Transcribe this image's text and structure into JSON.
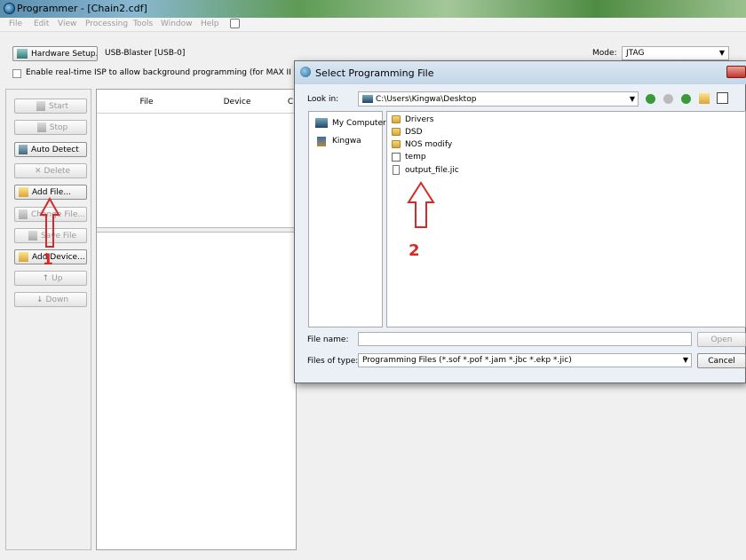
{
  "window": {
    "title": "Programmer - [Chain2.cdf]"
  },
  "menu": [
    "File",
    "Edit",
    "View",
    "Processing",
    "Tools",
    "Window",
    "Help"
  ],
  "toolbar": {
    "hardware_setup": "Hardware Setup...",
    "hardware_value": "USB-Blaster [USB-0]",
    "mode_label": "Mode:",
    "mode_value": "JTAG",
    "isp_checkbox": "Enable real-time ISP to allow background programming (for MAX II and MAX V"
  },
  "side_buttons": {
    "start": "Start",
    "stop": "Stop",
    "auto_detect": "Auto Detect",
    "delete": "Delete",
    "add_file": "Add File...",
    "change_file": "Change File...",
    "save_file": "Save File",
    "add_device": "Add Device...",
    "up": "Up",
    "down": "Down"
  },
  "grid": {
    "columns": [
      "File",
      "Device",
      "C"
    ]
  },
  "dialog": {
    "title": "Select Programming File",
    "look_in_label": "Look in:",
    "look_in_value": "C:\\Users\\Kingwa\\Desktop",
    "places": [
      "My Computer",
      "Kingwa"
    ],
    "files": [
      "Drivers",
      "DSD",
      "NOS modify",
      "temp",
      "output_file.jic"
    ],
    "file_name_label": "File name:",
    "file_name_value": "",
    "files_of_type_label": "Files of type:",
    "files_of_type_value": "Programming Files (*.sof *.pof *.jam *.jbc *.ekp *.jic)",
    "open": "Open",
    "cancel": "Cancel"
  },
  "annotations": {
    "step1": "1",
    "step2": "2"
  },
  "colors": {
    "annotation_red": "#d42a2a"
  }
}
